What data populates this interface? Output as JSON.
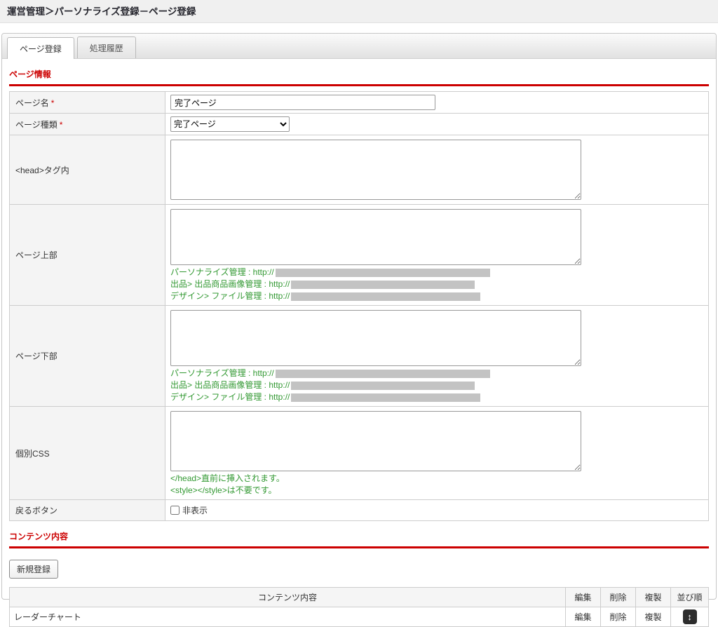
{
  "page": {
    "title": "運営管理＞パーソナライズ登録－ページ登録"
  },
  "tabs": [
    {
      "label": "ページ登録",
      "active": true
    },
    {
      "label": "処理履歴",
      "active": false
    }
  ],
  "sections": {
    "page_info": "ページ情報",
    "contents": "コンテンツ内容"
  },
  "form": {
    "required_mark": "*",
    "page_name": {
      "label": "ページ名",
      "value": "完了ページ"
    },
    "page_type": {
      "label": "ページ種類",
      "selected": "完了ページ"
    },
    "head_tag": {
      "label": "<head>タグ内",
      "value": ""
    },
    "page_top": {
      "label": "ページ上部",
      "value": "",
      "hints": [
        {
          "label": "パーソナライズ管理 : http://"
        },
        {
          "label": "出品> 出品商品画像管理 : http://"
        },
        {
          "label": "デザイン> ファイル管理 : http://"
        }
      ]
    },
    "page_bottom": {
      "label": "ページ下部",
      "value": "",
      "hints": [
        {
          "label": "パーソナライズ管理 : http://"
        },
        {
          "label": "出品> 出品商品画像管理 : http://"
        },
        {
          "label": "デザイン> ファイル管理 : http://"
        }
      ]
    },
    "custom_css": {
      "label": "個別CSS",
      "value": "",
      "hints": [
        {
          "label": "</head>直前に挿入されます。"
        },
        {
          "label": "<style></style>は不要です。"
        }
      ]
    },
    "back_button": {
      "label": "戻るボタン",
      "checkbox_label": "非表示",
      "checked": false
    }
  },
  "contents": {
    "new_button_label": "新規登録",
    "table": {
      "headers": [
        "コンテンツ内容",
        "編集",
        "削除",
        "複製",
        "並び順"
      ],
      "rows": [
        {
          "name": "レーダーチャート",
          "edit": "編集",
          "delete": "削除",
          "copy": "複製",
          "sort_glyph": "↕"
        }
      ]
    }
  },
  "colors": {
    "accent_red": "#cc0000",
    "hint_green": "#339933",
    "redaction_gray": "#c3c3c3",
    "label_cell_bg": "#f4f4f4"
  }
}
